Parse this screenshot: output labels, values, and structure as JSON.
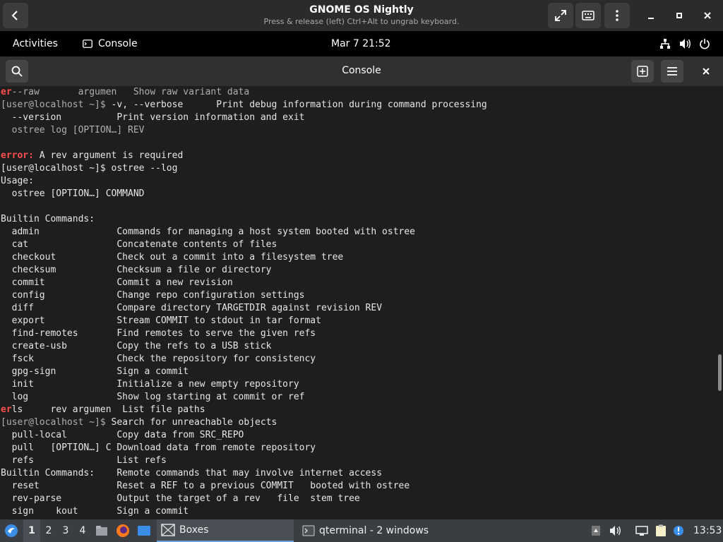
{
  "vm": {
    "title": "GNOME OS Nightly",
    "subtitle": "Press & release (left) Ctrl+Alt to ungrab keyboard."
  },
  "gnome": {
    "activities": "Activities",
    "app_name": "Console",
    "clock": "Mar 7  21:52"
  },
  "console": {
    "title": "Console"
  },
  "terminal": {
    "lines": [
      {
        "segments": [
          {
            "text": "er",
            "style": "err"
          },
          {
            "text": "--raw       argumen   Show raw variant data",
            "style": "ghost"
          }
        ]
      },
      {
        "segments": [
          {
            "text": "[user@localhost ~]$ ",
            "style": "ghost"
          },
          {
            "text": "-v, --verbose      Print debug information during command processing",
            "style": "normal"
          }
        ]
      },
      {
        "segments": [
          {
            "text": "  --version          Print version information and exit",
            "style": "normal"
          }
        ]
      },
      {
        "segments": [
          {
            "text": "  ostree log [OPTION…] REV",
            "style": "ghost"
          }
        ]
      },
      {
        "segments": []
      },
      {
        "segments": [
          {
            "text": "error:",
            "style": "err"
          },
          {
            "text": " A rev argument is required",
            "style": "normal"
          }
        ]
      },
      {
        "segments": [
          {
            "text": "[user@localhost ~]$ ostree --log",
            "style": "normal"
          }
        ]
      },
      {
        "segments": [
          {
            "text": "Usage:",
            "style": "normal"
          }
        ]
      },
      {
        "segments": [
          {
            "text": "  ostree [OPTION…] COMMAND",
            "style": "normal"
          }
        ]
      },
      {
        "segments": []
      },
      {
        "segments": [
          {
            "text": "Builtin Commands:",
            "style": "normal"
          }
        ]
      },
      {
        "segments": [
          {
            "text": "  admin              Commands for managing a host system booted with ostree",
            "style": "normal"
          }
        ]
      },
      {
        "segments": [
          {
            "text": "  cat                Concatenate contents of files",
            "style": "normal"
          }
        ]
      },
      {
        "segments": [
          {
            "text": "  checkout           Check out a commit into a filesystem tree",
            "style": "normal"
          }
        ]
      },
      {
        "segments": [
          {
            "text": "  checksum           Checksum a file or directory",
            "style": "normal"
          }
        ]
      },
      {
        "segments": [
          {
            "text": "  commit             Commit a new revision",
            "style": "normal"
          }
        ]
      },
      {
        "segments": [
          {
            "text": "  config             Change repo configuration settings",
            "style": "normal"
          }
        ]
      },
      {
        "segments": [
          {
            "text": "  diff               Compare directory TARGETDIR against revision REV",
            "style": "normal"
          }
        ]
      },
      {
        "segments": [
          {
            "text": "  export             Stream COMMIT to stdout in tar format",
            "style": "normal"
          }
        ]
      },
      {
        "segments": [
          {
            "text": "  find-remotes       Find remotes to serve the given refs",
            "style": "normal"
          }
        ]
      },
      {
        "segments": [
          {
            "text": "  create-usb         Copy the refs to a USB stick",
            "style": "normal"
          }
        ]
      },
      {
        "segments": [
          {
            "text": "  fsck               Check the repository for consistency",
            "style": "normal"
          }
        ]
      },
      {
        "segments": [
          {
            "text": "  gpg-sign           Sign a commit",
            "style": "normal"
          }
        ]
      },
      {
        "segments": [
          {
            "text": "  init               Initialize a new empty repository",
            "style": "normal"
          }
        ]
      },
      {
        "segments": [
          {
            "text": "  log                Show log starting at commit or ref",
            "style": "normal"
          }
        ]
      },
      {
        "segments": [
          {
            "text": "er",
            "style": "err"
          },
          {
            "text": "ls     rev argumen  List file paths",
            "style": "normal"
          }
        ]
      },
      {
        "segments": [
          {
            "text": "[user@localhost ~]$ ",
            "style": "ghost"
          },
          {
            "text": "Search for unreachable objects",
            "style": "normal"
          }
        ]
      },
      {
        "segments": [
          {
            "text": "  pull-local         Copy data from SRC_REPO",
            "style": "normal"
          }
        ]
      },
      {
        "segments": [
          {
            "text": "  pull   [OPTION…] C Download data from remote repository",
            "style": "normal"
          }
        ]
      },
      {
        "segments": [
          {
            "text": "  refs               List refs",
            "style": "normal"
          }
        ]
      },
      {
        "segments": [
          {
            "text": "Builtin Commands:    Remote commands that may involve internet access",
            "style": "normal"
          }
        ]
      },
      {
        "segments": [
          {
            "text": "  reset              Reset a REF to a previous COMMIT   booted with ostree",
            "style": "normal"
          }
        ]
      },
      {
        "segments": [
          {
            "text": "  rev-parse          Output the target of a rev   file  stem tree",
            "style": "normal"
          }
        ]
      },
      {
        "segments": [
          {
            "text": "  sign    kout       Sign a commit",
            "style": "normal"
          }
        ]
      }
    ]
  },
  "taskbar": {
    "workspaces": [
      "1",
      "2",
      "3",
      "4"
    ],
    "tasks": [
      {
        "label": "Boxes",
        "active": true
      },
      {
        "label": "qterminal - 2 windows",
        "active": false
      }
    ],
    "clock": "13:53"
  },
  "icons": {
    "back": "chevron-left-icon",
    "fullscreen": "fullscreen-icon",
    "keyboard": "keyboard-icon",
    "menu": "kebab-menu-icon",
    "minimize": "minimize-icon",
    "maximize": "maximize-icon",
    "close": "close-icon"
  }
}
